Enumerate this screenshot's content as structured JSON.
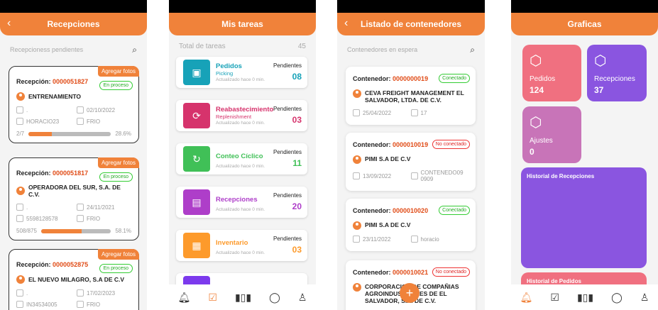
{
  "screen1": {
    "title": "Recepciones",
    "subtitle": "Recepcioness pendientes",
    "cards": [
      {
        "label": "Recepción:",
        "number": "0000051827",
        "badge": "Agregar fotos",
        "status": "En proceso",
        "client": "ENTRENAMIENTO",
        "field1": ".",
        "date": "02/10/2022",
        "user": "HORACIO23",
        "temp": "FRIO",
        "count": "2/7",
        "percent": "28.6%",
        "progress": 0.286
      },
      {
        "label": "Recepción:",
        "number": "0000051817",
        "badge": "Agregar fotos",
        "status": "En proceso",
        "client": "OPERADORA DEL SUR, S.A. DE C.V.",
        "field1": ".",
        "date": "24/11/2021",
        "user": "5598128578",
        "temp": "FRIO",
        "count": "508/875",
        "percent": "58.1%",
        "progress": 0.581
      },
      {
        "label": "Recepción:",
        "number": "0000052875",
        "badge": "Agregar fotos",
        "status": "En proceso",
        "client": "EL NUEVO MILAGRO, S.A DE C.V",
        "field1": ".",
        "date": "17/02/2023",
        "user": "IN34534005",
        "temp": "FRIO"
      }
    ]
  },
  "screen2": {
    "title": "Mis tareas",
    "total_label": "Total de tareas",
    "total_value": "45",
    "pending_label": "Pendientes",
    "updated": "Actualizado hace 0 min.",
    "tasks": [
      {
        "name": "Pedidos",
        "sub": "Picking",
        "count": "08",
        "color": "#17a2b8"
      },
      {
        "name": "Reabastecimiento",
        "sub": "Replenishment",
        "count": "03",
        "color": "#d6336c"
      },
      {
        "name": "Conteo Cíclico",
        "sub": "",
        "count": "11",
        "color": "#40c057"
      },
      {
        "name": "Recepciones",
        "sub": "",
        "count": "20",
        "color": "#ae3ec9"
      },
      {
        "name": "Inventario",
        "sub": "",
        "count": "03",
        "color": "#fd9a2b"
      }
    ]
  },
  "screen3": {
    "title": "Listado de contenedores",
    "subtitle": "Contenedores en espera",
    "label": "Contenedor:",
    "containers": [
      {
        "number": "0000000019",
        "status": "Conectado",
        "online": true,
        "client": "CEVA FREIGHT MANAGEMENT EL SALVADOR, LTDA. DE C.V.",
        "date": "25/04/2022",
        "extra": "17"
      },
      {
        "number": "0000010019",
        "status": "No conectado",
        "online": false,
        "client": "PIMI S.A DE C.V",
        "date": "13/09/2022",
        "extra": "CONTENEDO09 0909"
      },
      {
        "number": "0000010020",
        "status": "Conectado",
        "online": true,
        "client": "PIMI S.A DE C.V",
        "date": "23/11/2022",
        "extra": "horacio"
      },
      {
        "number": "0000010021",
        "status": "No conectado",
        "online": false,
        "client": "CORPORACION DE COMPAÑIAS AGROINDUSTRIALES DE EL SALVADOR, S.A. DE C.V."
      }
    ],
    "fab": "+"
  },
  "screen4": {
    "title": "Graficas",
    "tiles": [
      {
        "name": "Pedidos",
        "value": "124",
        "color": "#f07080"
      },
      {
        "name": "Recepciones",
        "value": "37",
        "color": "#8a55e0"
      },
      {
        "name": "Ajustes",
        "value": "0",
        "color": "#c874b8"
      }
    ],
    "hist1": "Historial de Recepciones",
    "hist2": "Historial de Pedidos"
  }
}
